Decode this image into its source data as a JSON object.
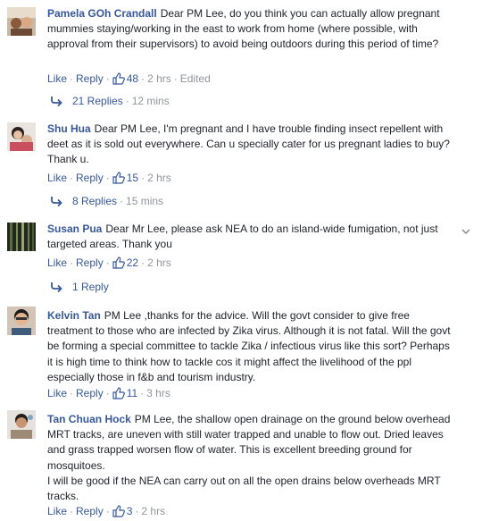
{
  "comments": [
    {
      "author": "Pamela GOh Crandall",
      "text": "Dear PM Lee, do you think you can actually allow pregnant mummies staying/working in the east to work from home (where possible, with approval from their supervisors) to avoid being outdoors during this period of time?",
      "like": "Like",
      "reply": "Reply",
      "likes": "48",
      "time": "2 hrs",
      "edited": "Edited",
      "replies_label": "21 Replies",
      "replies_time": "12 mins"
    },
    {
      "author": "Shu Hua",
      "text": "Dear PM Lee, I'm pregnant and I have trouble finding insect repellent with deet as it is sold out everywhere. Can u specially cater for us pregnant ladies to buy? Thank u.",
      "like": "Like",
      "reply": "Reply",
      "likes": "15",
      "time": "2 hrs",
      "replies_label": "8 Replies",
      "replies_time": "15 mins"
    },
    {
      "author": "Susan Pua",
      "text": "Dear Mr Lee, please ask NEA to do an island-wide fumigation, not just targeted areas. Thank you",
      "like": "Like",
      "reply": "Reply",
      "likes": "22",
      "time": "2 hrs",
      "replies_label": "1 Reply"
    },
    {
      "author": "Kelvin Tan",
      "text": "PM Lee ,thanks for the advice. Will the govt consider to give free treatment to those who are infected by Zika virus. Although it is not fatal. Will the govt be forming a special committee to tackle Zika / infectious virus like this sort? Perhaps it is high time to think how to tackle cos it might affect the livelihood of the ppl especially those in f&b and tourism industry.",
      "like": "Like",
      "reply": "Reply",
      "likes": "11",
      "time": "3 hrs"
    },
    {
      "author": "Tan Chuan Hock",
      "text": "PM Lee, the shallow open drainage on the ground below overhead MRT tracks, are uneven with still water trapped and unable to flow out. Dried leaves and grass trapped worsen flow of water. This is excellent breeding ground for mosquitoes.",
      "text2": "I will be good if the NEA can carry out on all the open drains below overheads MRT tracks.",
      "like": "Like",
      "reply": "Reply",
      "likes": "3",
      "time": "2 hrs"
    }
  ],
  "icons": {
    "like": "thumbs-up-icon",
    "reply_arrow": "reply-arrow-icon",
    "menu": "chevron-down-icon"
  },
  "colors": {
    "link": "#365899",
    "text": "#1d2129",
    "muted": "#90949c"
  }
}
